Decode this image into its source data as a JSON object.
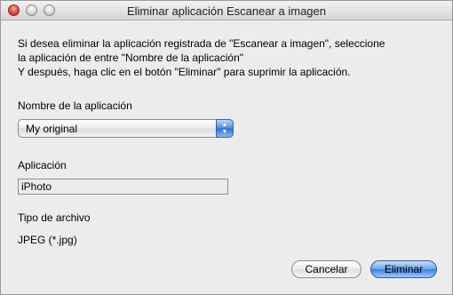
{
  "window": {
    "title": "Eliminar aplicación Escanear a imagen"
  },
  "description": {
    "line1": "Si desea eliminar la aplicación registrada de \"Escanear a imagen\", seleccione",
    "line2": "la aplicación de entre \"Nombre de la aplicación\"",
    "line3": "Y después, haga clic en el botón \"Eliminar\" para suprimir la aplicación."
  },
  "app_name": {
    "label": "Nombre de la aplicación",
    "selected": "My original"
  },
  "application": {
    "label": "Aplicación",
    "value": "iPhoto"
  },
  "file_type": {
    "label": "Tipo de archivo",
    "value": "JPEG (*.jpg)"
  },
  "buttons": {
    "cancel": "Cancelar",
    "delete": "Eliminar"
  }
}
